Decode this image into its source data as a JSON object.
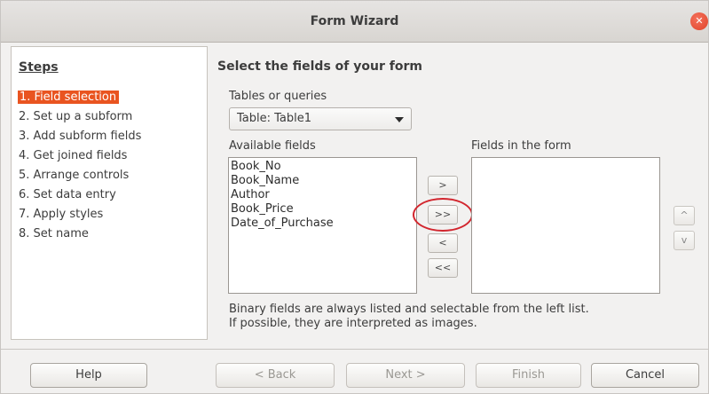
{
  "window": {
    "title": "Form Wizard",
    "close_icon": "✕"
  },
  "steps": {
    "title": "Steps",
    "items": [
      {
        "label": "1. Field selection"
      },
      {
        "label": "2. Set up a subform"
      },
      {
        "label": "3. Add subform fields"
      },
      {
        "label": "4. Get joined fields"
      },
      {
        "label": "5. Arrange controls"
      },
      {
        "label": "6. Set data entry"
      },
      {
        "label": "7. Apply styles"
      },
      {
        "label": "8. Set name"
      }
    ],
    "active_index": 0
  },
  "main": {
    "title": "Select the fields of your form",
    "tables_label": "Tables or queries",
    "tables_value": "Table: Table1",
    "available_label": "Available fields",
    "available_fields": [
      "Book_No",
      "Book_Name",
      "Author",
      "Book_Price",
      "Date_of_Purchase"
    ],
    "form_label": "Fields in the form",
    "form_fields": [],
    "move_buttons": {
      "add_one": ">",
      "add_all": ">>",
      "remove_one": "<",
      "remove_all": "<<"
    },
    "order_buttons": {
      "up": "^",
      "down": "v"
    },
    "note_line1": "Binary fields are always listed and selectable from the left list.",
    "note_line2": "If possible, they are interpreted as images."
  },
  "footer": {
    "help": "Help",
    "back": "< Back",
    "next": "Next >",
    "finish": "Finish",
    "cancel": "Cancel"
  },
  "colors": {
    "accent": "#e95420",
    "annotation_ring": "#d2262e"
  }
}
